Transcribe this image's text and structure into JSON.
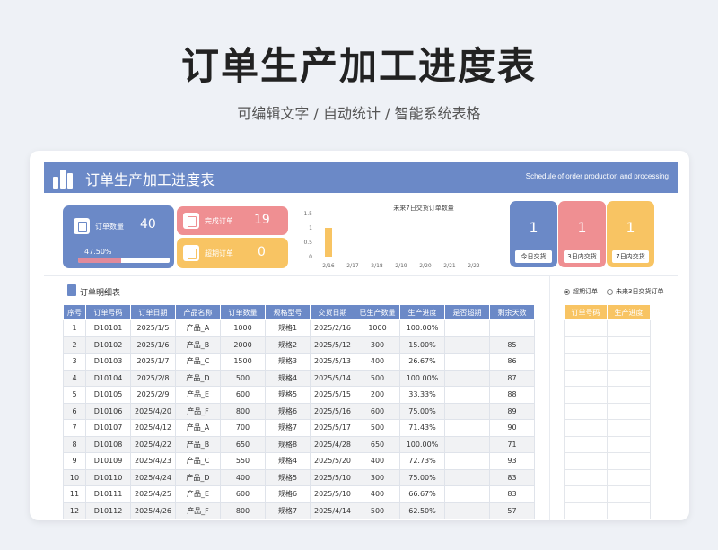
{
  "page": {
    "title": "订单生产加工进度表",
    "subtitle": "可编辑文字 / 自动统计 / 智能系统表格"
  },
  "banner": {
    "title": "订单生产加工进度表",
    "subtitle_en": "Schedule of order production and processing"
  },
  "stats": {
    "order_count": {
      "label": "订单数量",
      "value": "40"
    },
    "progress": {
      "text": "47.50%",
      "fraction": 0.475
    },
    "completed": {
      "label": "完成订单",
      "value": "19"
    },
    "overdue": {
      "label": "超期订单",
      "value": "0"
    }
  },
  "day_cards": [
    {
      "value": "1",
      "label": "今日交货",
      "color": "#6b89c7"
    },
    {
      "value": "1",
      "label": "3日内交货",
      "color": "#ef8f92"
    },
    {
      "value": "1",
      "label": "7日内交货",
      "color": "#f8c463"
    }
  ],
  "chart_data": {
    "type": "bar",
    "title": "未来7日交货订单数量",
    "categories": [
      "2/16",
      "2/17",
      "2/18",
      "2/19",
      "2/20",
      "2/21",
      "2/22"
    ],
    "values": [
      1,
      0,
      0,
      0,
      0,
      0,
      0
    ],
    "ylim": [
      0,
      1.5
    ],
    "yticks": [
      "1.5",
      "1",
      "0.5",
      "0"
    ],
    "color": "#f8c463"
  },
  "detail": {
    "title": "订单明细表",
    "columns": [
      "序号",
      "订单号码",
      "订单日期",
      "产品名称",
      "订单数量",
      "规格型号",
      "交货日期",
      "已生产数量",
      "生产进度",
      "是否超期",
      "剩余天数"
    ],
    "rows": [
      [
        "1",
        "D10101",
        "2025/1/5",
        "产品_A",
        "1000",
        "规格1",
        "2025/2/16",
        "1000",
        "100.00%",
        "",
        ""
      ],
      [
        "2",
        "D10102",
        "2025/1/6",
        "产品_B",
        "2000",
        "规格2",
        "2025/5/12",
        "300",
        "15.00%",
        "",
        "85"
      ],
      [
        "3",
        "D10103",
        "2025/1/7",
        "产品_C",
        "1500",
        "规格3",
        "2025/5/13",
        "400",
        "26.67%",
        "",
        "86"
      ],
      [
        "4",
        "D10104",
        "2025/2/8",
        "产品_D",
        "500",
        "规格4",
        "2025/5/14",
        "500",
        "100.00%",
        "",
        "87"
      ],
      [
        "5",
        "D10105",
        "2025/2/9",
        "产品_E",
        "600",
        "规格5",
        "2025/5/15",
        "200",
        "33.33%",
        "",
        "88"
      ],
      [
        "6",
        "D10106",
        "2025/4/20",
        "产品_F",
        "800",
        "规格6",
        "2025/5/16",
        "600",
        "75.00%",
        "",
        "89"
      ],
      [
        "7",
        "D10107",
        "2025/4/12",
        "产品_A",
        "700",
        "规格7",
        "2025/5/17",
        "500",
        "71.43%",
        "",
        "90"
      ],
      [
        "8",
        "D10108",
        "2025/4/22",
        "产品_B",
        "650",
        "规格8",
        "2025/4/28",
        "650",
        "100.00%",
        "",
        "71"
      ],
      [
        "9",
        "D10109",
        "2025/4/23",
        "产品_C",
        "550",
        "规格4",
        "2025/5/20",
        "400",
        "72.73%",
        "",
        "93"
      ],
      [
        "10",
        "D10110",
        "2025/4/24",
        "产品_D",
        "400",
        "规格5",
        "2025/5/10",
        "300",
        "75.00%",
        "",
        "83"
      ],
      [
        "11",
        "D10111",
        "2025/4/25",
        "产品_E",
        "600",
        "规格6",
        "2025/5/10",
        "400",
        "66.67%",
        "",
        "83"
      ],
      [
        "12",
        "D10112",
        "2025/4/26",
        "产品_F",
        "800",
        "规格7",
        "2025/4/14",
        "500",
        "62.50%",
        "",
        "57"
      ]
    ]
  },
  "side": {
    "radio_overdue": "超期订单",
    "radio_soon": "未来3日交货订单",
    "columns": [
      "订单号码",
      "生产进度"
    ]
  }
}
